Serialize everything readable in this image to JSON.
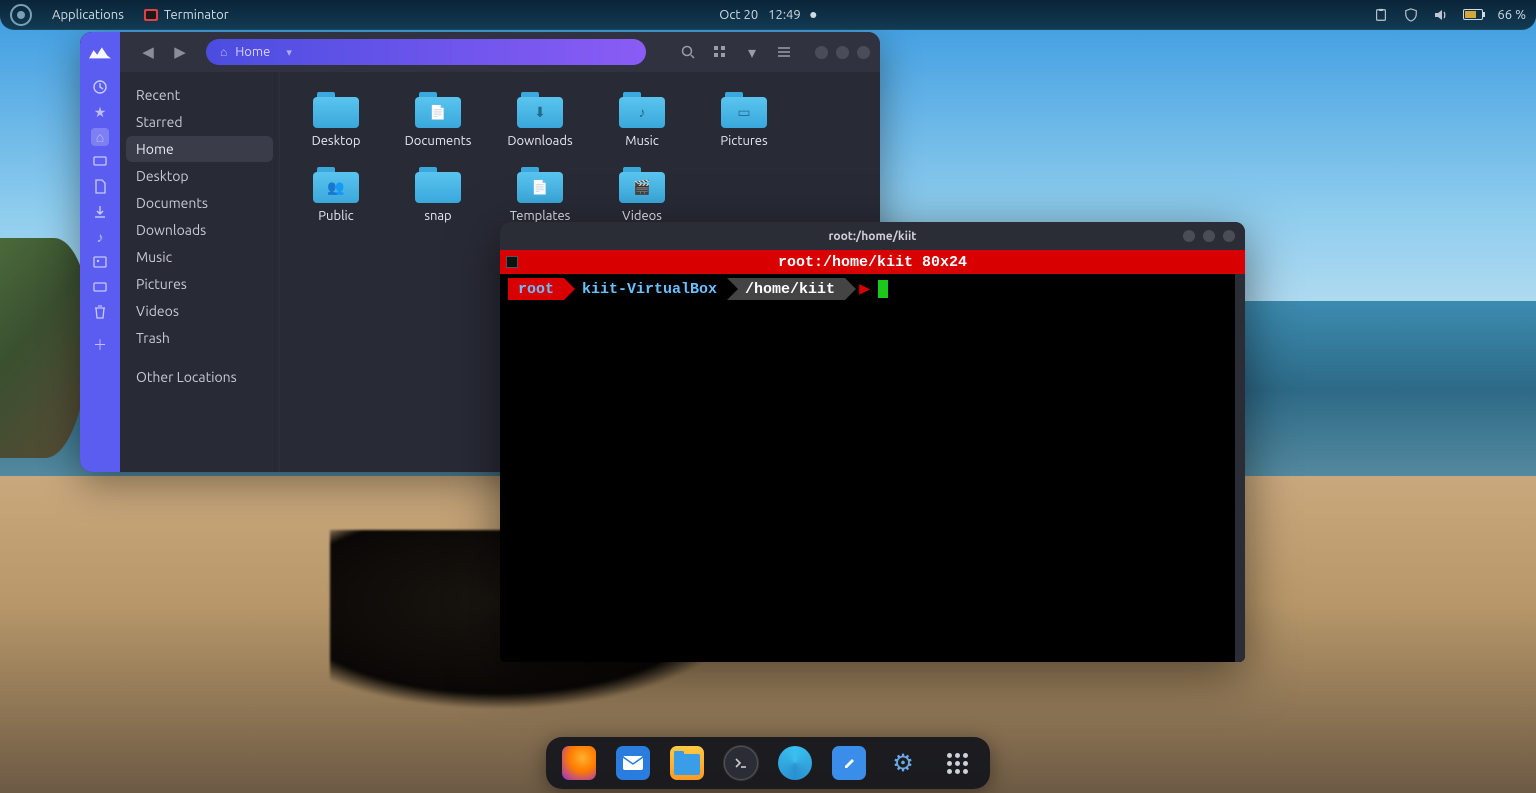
{
  "topbar": {
    "menu_label": "Applications",
    "active_app": "Terminator",
    "date": "Oct 20",
    "time": "12:49",
    "battery_pct": "66 %"
  },
  "files": {
    "path_label": "Home",
    "places": {
      "recent": "Recent",
      "starred": "Starred",
      "home": "Home",
      "desktop": "Desktop",
      "documents": "Documents",
      "downloads": "Downloads",
      "music": "Music",
      "pictures": "Pictures",
      "videos": "Videos",
      "trash": "Trash",
      "other": "Other Locations"
    },
    "folders": [
      {
        "label": "Desktop",
        "glyph": ""
      },
      {
        "label": "Documents",
        "glyph": "📄"
      },
      {
        "label": "Downloads",
        "glyph": "⬇"
      },
      {
        "label": "Music",
        "glyph": "♪"
      },
      {
        "label": "Pictures",
        "glyph": "▭"
      },
      {
        "label": "Public",
        "glyph": "👥"
      },
      {
        "label": "snap",
        "glyph": ""
      },
      {
        "label": "Templates",
        "glyph": "📄"
      },
      {
        "label": "Videos",
        "glyph": "🎬"
      }
    ]
  },
  "terminal": {
    "title": "root:/home/kiit",
    "barline": "root:/home/kiit 80x24",
    "prompt_user": "root",
    "prompt_host": "kiit-VirtualBox",
    "prompt_path": "/home/kiit"
  },
  "dock": {
    "items": [
      "firefox",
      "mail",
      "files",
      "terminal",
      "blue-app",
      "text-editor",
      "settings",
      "app-grid"
    ]
  }
}
